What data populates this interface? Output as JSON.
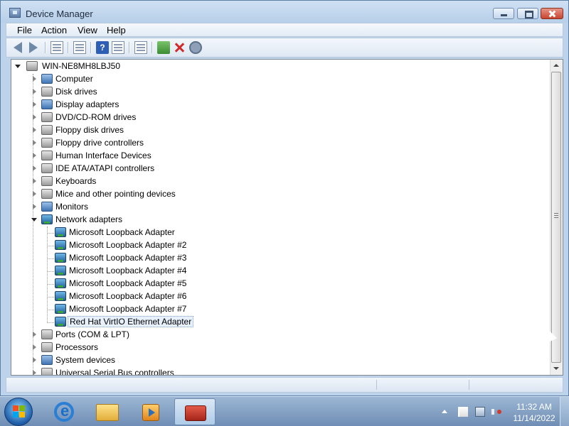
{
  "window": {
    "title": "Device Manager",
    "menu": [
      "File",
      "Action",
      "View",
      "Help"
    ]
  },
  "toolbar": {
    "buttons": [
      "back-icon",
      "forward-icon",
      "show-hide-console-tree-icon",
      "properties-icon",
      "help-icon",
      "action-pane-icon",
      "scan-hardware-icon",
      "update-driver-icon",
      "uninstall-icon",
      "disable-icon"
    ]
  },
  "tree": {
    "root": "WIN-NE8MH8LBJ50",
    "categories": [
      "Computer",
      "Disk drives",
      "Display adapters",
      "DVD/CD-ROM drives",
      "Floppy disk drives",
      "Floppy drive controllers",
      "Human Interface Devices",
      "IDE ATA/ATAPI controllers",
      "Keyboards",
      "Mice and other pointing devices",
      "Monitors",
      "Network adapters"
    ],
    "network_adapters": [
      "Microsoft Loopback Adapter",
      "Microsoft Loopback Adapter #2",
      "Microsoft Loopback Adapter #3",
      "Microsoft Loopback Adapter #4",
      "Microsoft Loopback Adapter #5",
      "Microsoft Loopback Adapter #6",
      "Microsoft Loopback Adapter #7",
      "Red Hat VirtIO Ethernet Adapter"
    ],
    "selected": "Red Hat VirtIO Ethernet Adapter",
    "after": [
      "Ports (COM & LPT)",
      "Processors",
      "System devices",
      "Universal Serial Bus controllers"
    ]
  },
  "taskbar": {
    "pinned": [
      "internet-explorer-icon",
      "file-explorer-icon",
      "media-player-icon",
      "device-manager-icon"
    ],
    "active": "device-manager-icon",
    "clock_time": "11:32 AM",
    "clock_date": "11/14/2022"
  }
}
